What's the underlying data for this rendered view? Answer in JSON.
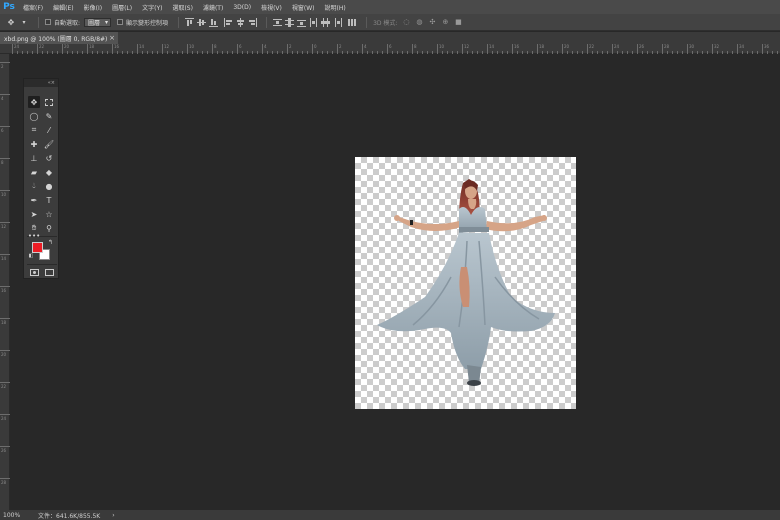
{
  "app": {
    "logo": "Ps"
  },
  "menu": [
    "檔案(F)",
    "編輯(E)",
    "影像(I)",
    "圖層(L)",
    "文字(Y)",
    "選取(S)",
    "濾鏡(T)",
    "3D(D)",
    "檢視(V)",
    "視窗(W)",
    "說明(H)"
  ],
  "options": {
    "auto_select_label": "自動選取:",
    "auto_select_value": "圖層",
    "show_transform_label": "顯示變形控制項",
    "mode_3d_label": "3D 模式:"
  },
  "tab": {
    "title": "xbd.png @ 100% (圖層 0, RGB/8#)",
    "close": "×"
  },
  "ruler": {
    "h_labels": [
      "24",
      "22",
      "20",
      "18",
      "16",
      "14",
      "12",
      "10",
      "8",
      "6",
      "4",
      "2",
      "0",
      "2",
      "4",
      "6",
      "8",
      "10",
      "12",
      "14",
      "16",
      "18",
      "20",
      "22",
      "24",
      "26",
      "28",
      "30",
      "32",
      "34",
      "36"
    ],
    "v_labels": [
      "2",
      "4",
      "6",
      "8",
      "10",
      "12",
      "14",
      "16",
      "18",
      "20",
      "22",
      "24",
      "26",
      "28"
    ]
  },
  "tools": {
    "header": "«×"
  },
  "colors": {
    "foreground": "#ed1c24",
    "background": "#ffffff",
    "accent": "#31a8ff"
  },
  "status": {
    "zoom": "100%",
    "doc_info": "文件：641.6K/855.5K",
    "arrow": "›"
  }
}
